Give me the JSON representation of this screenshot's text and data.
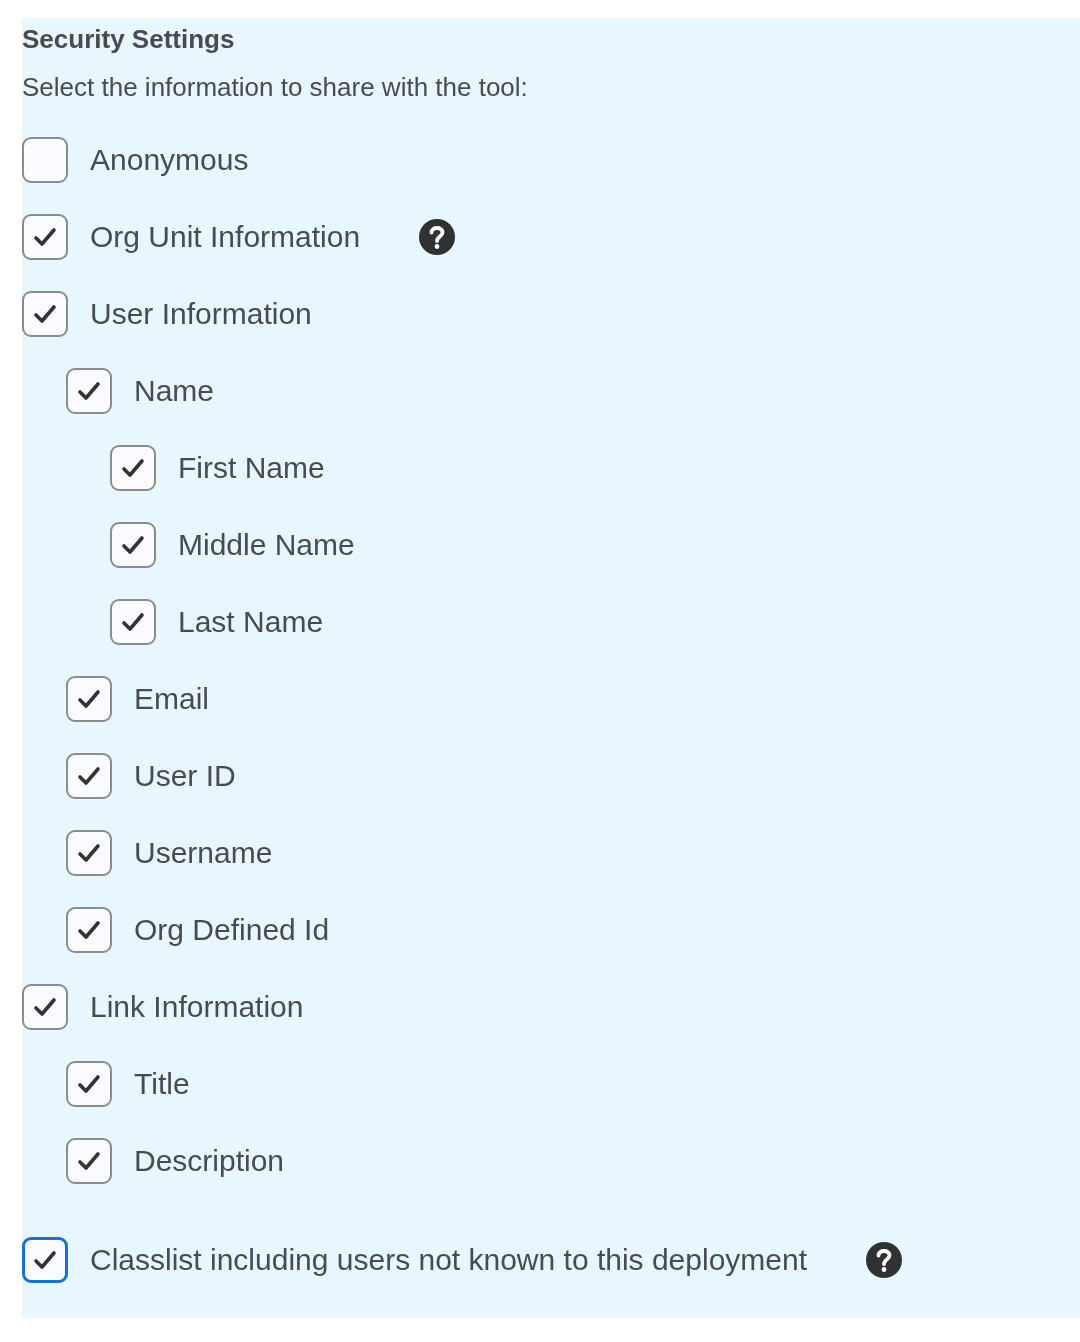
{
  "title": "Security Settings",
  "instruction": "Select the information to share with the tool:",
  "items": [
    {
      "label": "Anonymous",
      "checked": false,
      "focused": false,
      "help": false
    },
    {
      "label": "Org Unit Information",
      "checked": true,
      "focused": false,
      "help": true
    },
    {
      "label": "User Information",
      "checked": true,
      "focused": false,
      "help": false,
      "children": [
        {
          "label": "Name",
          "checked": true,
          "focused": false,
          "help": false,
          "children": [
            {
              "label": "First Name",
              "checked": true,
              "focused": false,
              "help": false
            },
            {
              "label": "Middle Name",
              "checked": true,
              "focused": false,
              "help": false
            },
            {
              "label": "Last Name",
              "checked": true,
              "focused": false,
              "help": false
            }
          ]
        },
        {
          "label": "Email",
          "checked": true,
          "focused": false,
          "help": false
        },
        {
          "label": "User ID",
          "checked": true,
          "focused": false,
          "help": false
        },
        {
          "label": "Username",
          "checked": true,
          "focused": false,
          "help": false
        },
        {
          "label": "Org Defined Id",
          "checked": true,
          "focused": false,
          "help": false
        }
      ]
    },
    {
      "label": "Link Information",
      "checked": true,
      "focused": false,
      "help": false,
      "children": [
        {
          "label": "Title",
          "checked": true,
          "focused": false,
          "help": false
        },
        {
          "label": "Description",
          "checked": true,
          "focused": false,
          "help": false
        }
      ]
    },
    {
      "label": "Classlist including users not known to this deployment",
      "checked": true,
      "focused": true,
      "help": true
    }
  ]
}
